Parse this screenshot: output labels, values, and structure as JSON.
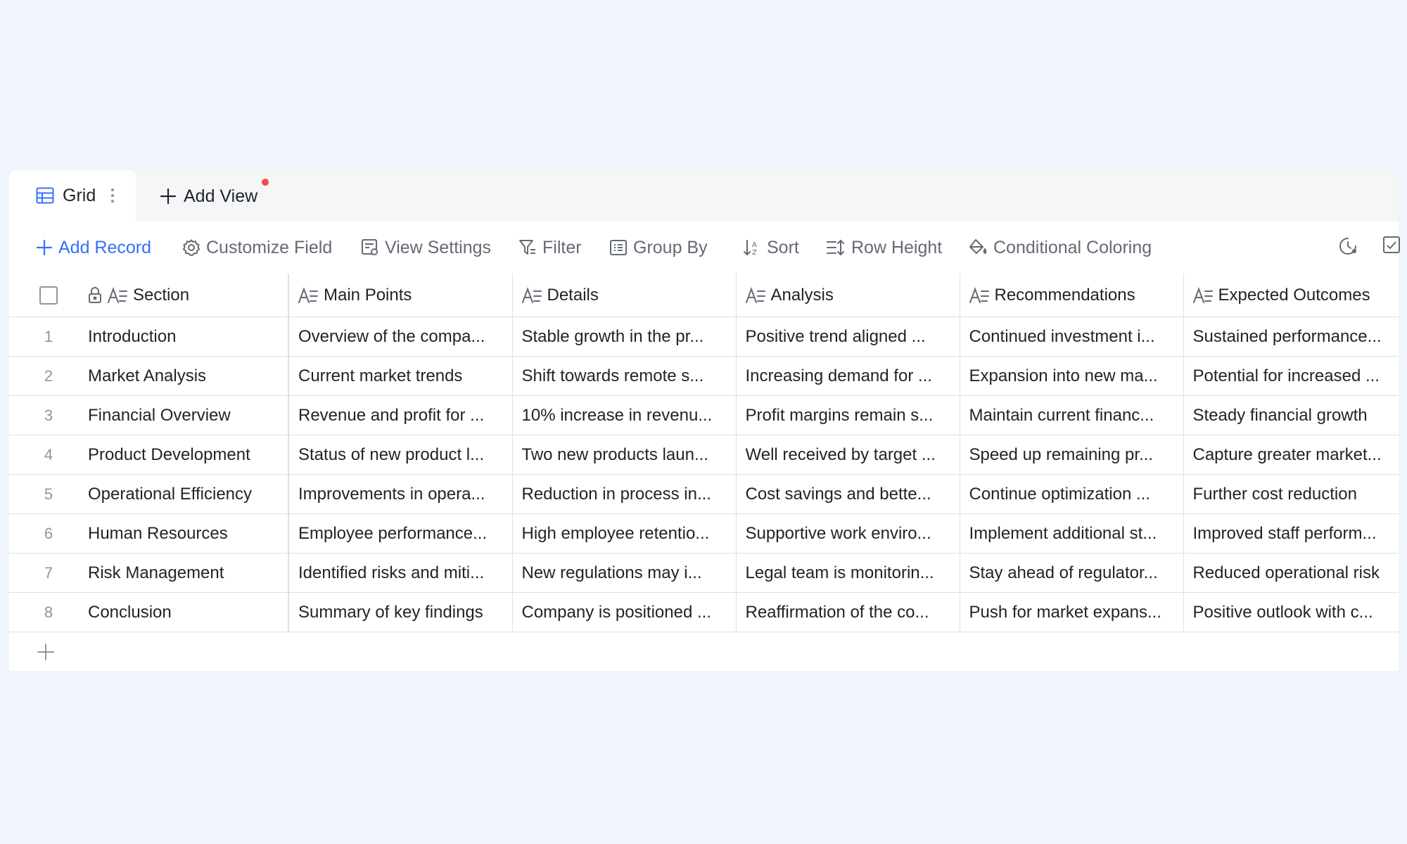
{
  "tabs": {
    "active_label": "Grid",
    "add_view_label": "Add View"
  },
  "toolbar": {
    "add_record": "Add Record",
    "customize_field": "Customize Field",
    "view_settings": "View Settings",
    "filter": "Filter",
    "group_by": "Group By",
    "sort": "Sort",
    "row_height": "Row Height",
    "conditional_coloring": "Conditional Coloring"
  },
  "table": {
    "columns": [
      "Section",
      "Main Points",
      "Details",
      "Analysis",
      "Recommendations",
      "Expected Outcomes"
    ],
    "rows": [
      {
        "index": "1",
        "cells": [
          "Introduction",
          "Overview of the compa...",
          "Stable growth in the pr...",
          "Positive trend aligned ...",
          "Continued investment i...",
          "Sustained performance..."
        ]
      },
      {
        "index": "2",
        "cells": [
          "Market Analysis",
          "Current market trends",
          "Shift towards remote s...",
          "Increasing demand for ...",
          "Expansion into new ma...",
          "Potential for increased ..."
        ]
      },
      {
        "index": "3",
        "cells": [
          "Financial Overview",
          "Revenue and profit for ...",
          "10% increase in revenu...",
          "Profit margins remain s...",
          "Maintain current financ...",
          "Steady financial growth"
        ]
      },
      {
        "index": "4",
        "cells": [
          "Product Development",
          "Status of new product l...",
          "Two new products laun...",
          "Well received by target ...",
          "Speed up remaining pr...",
          "Capture greater market..."
        ]
      },
      {
        "index": "5",
        "cells": [
          "Operational Efficiency",
          "Improvements in opera...",
          "Reduction in process in...",
          "Cost savings and bette...",
          "Continue optimization ...",
          "Further cost reduction"
        ]
      },
      {
        "index": "6",
        "cells": [
          "Human Resources",
          "Employee performance...",
          "High employee retentio...",
          "Supportive work enviro...",
          "Implement additional st...",
          "Improved staff perform..."
        ]
      },
      {
        "index": "7",
        "cells": [
          "Risk Management",
          "Identified risks and miti...",
          "New regulations may i...",
          "Legal team is monitorin...",
          "Stay ahead of regulator...",
          "Reduced operational risk"
        ]
      },
      {
        "index": "8",
        "cells": [
          "Conclusion",
          "Summary of key findings",
          "Company is positioned ...",
          "Reaffirmation of the co...",
          "Push for market expans...",
          "Positive outlook with c..."
        ]
      }
    ]
  },
  "colors": {
    "accent": "#3370ff",
    "text": "#1f2329",
    "muted": "#646a73",
    "border": "#dee0e3",
    "background": "#f0f4fd",
    "notification_dot": "#f54a45"
  }
}
